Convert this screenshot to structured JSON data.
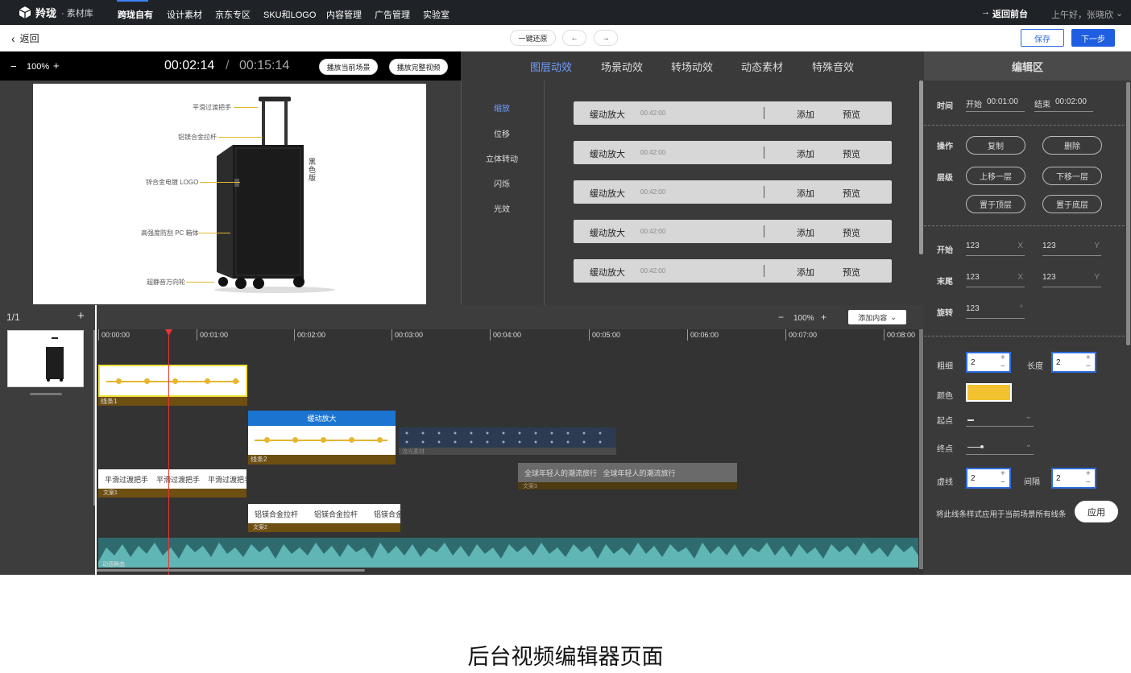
{
  "topnav": {
    "brand": "羚珑",
    "brand_sub": "· 素材库",
    "items": [
      "跨珑自有",
      "设计素材",
      "京东专区",
      "SKU和LOGO",
      "内容管理",
      "广告管理",
      "实验室"
    ],
    "back_front": "返回前台",
    "greeting": "上午好，张晓欣"
  },
  "subbar": {
    "back": "返回",
    "restore": "一键还原",
    "undo": "←",
    "redo": "→",
    "save": "保存",
    "next": "下一步"
  },
  "preview": {
    "zoom_minus": "−",
    "zoom": "100%",
    "zoom_plus": "+",
    "current_time": "00:02:14",
    "sep": "/",
    "total_time": "00:15:14",
    "play_scene": "播放当前场景",
    "play_full": "播放完整视频",
    "annotations": [
      "平滑过渡把手",
      "铝镁合金拉杆",
      "锌合金电镀 LOGO",
      "高强度防刮 PC 箱体",
      "超静音万向轮"
    ],
    "side_text": "黑色版"
  },
  "effects": {
    "tabs": [
      "图层动效",
      "场景动效",
      "转场动效",
      "动态素材",
      "特殊音效"
    ],
    "active_tab": 0,
    "categories": [
      "缩放",
      "位移",
      "立体转动",
      "闪烁",
      "光效"
    ],
    "active_category": 0,
    "rows": [
      {
        "name": "缓动放大",
        "time": "00:42:00",
        "add": "添加",
        "preview": "预览"
      },
      {
        "name": "缓动放大",
        "time": "00:42:00",
        "add": "添加",
        "preview": "预览"
      },
      {
        "name": "缓动放大",
        "time": "00:42:00",
        "add": "添加",
        "preview": "预览"
      },
      {
        "name": "缓动放大",
        "time": "00:42:00",
        "add": "添加",
        "preview": "预览"
      },
      {
        "name": "缓动放大",
        "time": "00:42:00",
        "add": "添加",
        "preview": "预览"
      }
    ]
  },
  "editor": {
    "title": "编辑区",
    "time_label": "时间",
    "start_label": "开始",
    "start_time": "00:01:00",
    "end_label": "结束",
    "end_time": "00:02:00",
    "op_label": "操作",
    "copy": "复制",
    "delete": "删除",
    "layer_label": "层级",
    "layer_up": "上移一层",
    "layer_down": "下移一层",
    "to_top": "置于顶层",
    "to_bottom": "置于底层",
    "begin_label": "开始",
    "begin_x": "123",
    "begin_y": "123",
    "tail_label": "末尾",
    "tail_x": "123",
    "tail_y": "123",
    "x": "X",
    "y": "Y",
    "rotate_label": "旋转",
    "rotate": "123",
    "deg": "°",
    "thickness_label": "粗细",
    "thickness": "2",
    "length_label": "长度",
    "length": "2",
    "color_label": "颜色",
    "color": "#f2c230",
    "start_pt_label": "起点",
    "end_pt_label": "终点",
    "dash_label": "虚线",
    "dash": "2",
    "gap_label": "间隔",
    "gap": "2",
    "apply_text": "将此线条样式应用于当前场景所有线条",
    "apply": "应用"
  },
  "timeline": {
    "page": "1/1",
    "add": "+",
    "zoom_minus": "−",
    "zoom": "100%",
    "zoom_plus": "+",
    "add_content": "添加内容",
    "ticks": [
      "00:00:00",
      "00:01:00",
      "00:02:00",
      "00:03:00",
      "00:04:00",
      "00:05:00",
      "00:06:00",
      "00:07:00",
      "00:08:00"
    ],
    "line1": "线条1",
    "line2": "线条2",
    "anim_label": "缓动放大",
    "material": "流光素材",
    "text1_items": [
      "平滑过渡把手",
      "平滑过渡把手",
      "平滑过渡把手"
    ],
    "text1": "文案1",
    "text2_items": [
      "铝镁合金拉杆",
      "铝镁合金拉杆",
      "铝镁合金"
    ],
    "text2": "文案2",
    "text3_content": "全球年轻人的潮流旅行   全球年轻人的潮流旅行",
    "text3": "文案3",
    "audio": "动感舞曲"
  },
  "footer": {
    "caption": "后台视频编辑器页面"
  }
}
